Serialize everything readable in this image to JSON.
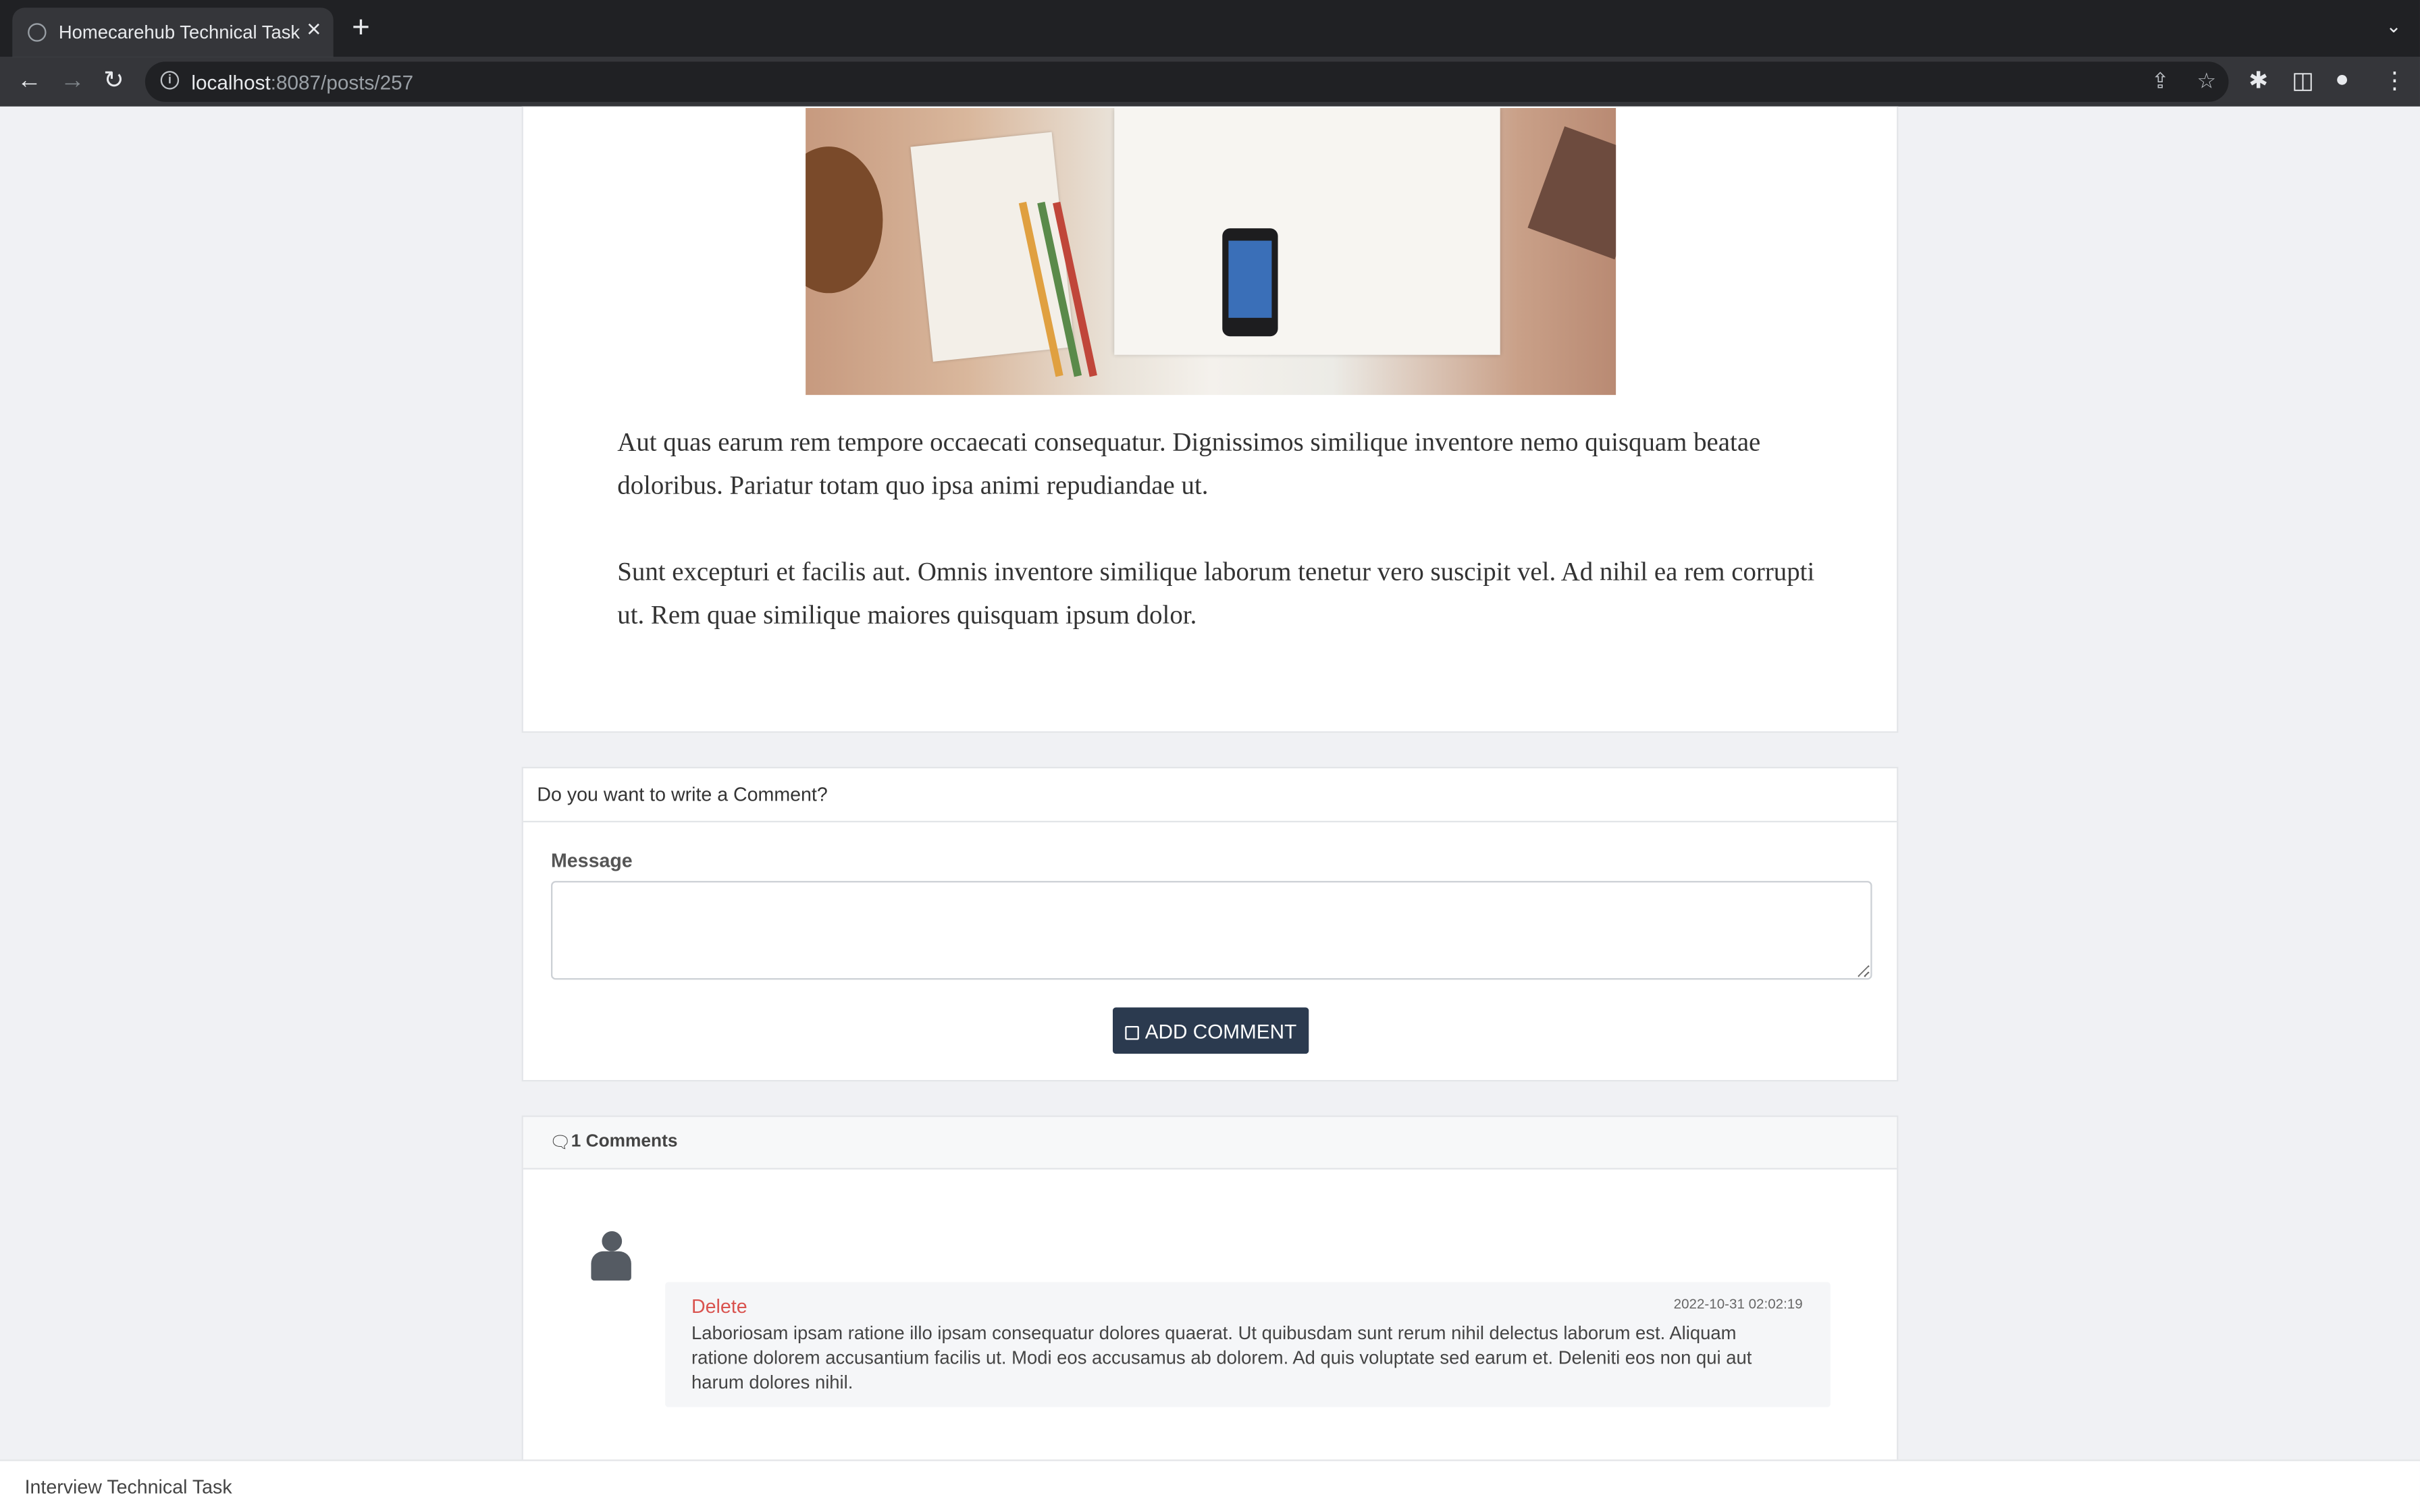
{
  "browser": {
    "tab_title": "Homecarehub Technical Task",
    "url_host": "localhost",
    "url_rest": ":8087/posts/257"
  },
  "post": {
    "paragraphs": [
      "Aut quas earum rem tempore occaecati consequatur. Dignissimos similique inventore nemo quisquam beatae doloribus. Pariatur totam quo ipsa animi repudiandae ut.",
      "Sunt excepturi et facilis aut. Omnis inventore similique laborum tenetur vero suscipit vel. Ad nihil ea rem corrupti ut. Rem quae similique maiores quisquam ipsum dolor."
    ]
  },
  "comment_form": {
    "heading": "Do you want to write a Comment?",
    "message_label": "Message",
    "message_value": "",
    "submit_label": "ADD COMMENT"
  },
  "comments": {
    "count_label": "1 Comments",
    "items": [
      {
        "delete_label": "Delete",
        "date": "2022-10-31 02:02:19",
        "body": "Laboriosam ipsam ratione illo ipsam consequatur dolores quaerat. Ut quibusdam sunt rerum nihil delectus laborum est. Aliquam ratione dolorem accusantium facilis ut. Modi eos accusamus ab dolorem. Ad quis voluptate sed earum et. Deleniti eos non qui aut harum dolores nihil."
      }
    ]
  },
  "footer": {
    "text": "Interview Technical Task"
  },
  "colors": {
    "accent": "#2b3a4f",
    "delete": "#d9534f",
    "page_bg": "#f0f1f4"
  },
  "icons": [
    "globe-icon",
    "close-icon",
    "plus-icon",
    "back-icon",
    "forward-icon",
    "reload-icon",
    "info-icon",
    "share-icon",
    "star-icon",
    "extensions-icon",
    "sidepanel-icon",
    "profile-icon",
    "menu-icon",
    "save-icon",
    "comments-icon",
    "user-icon"
  ]
}
